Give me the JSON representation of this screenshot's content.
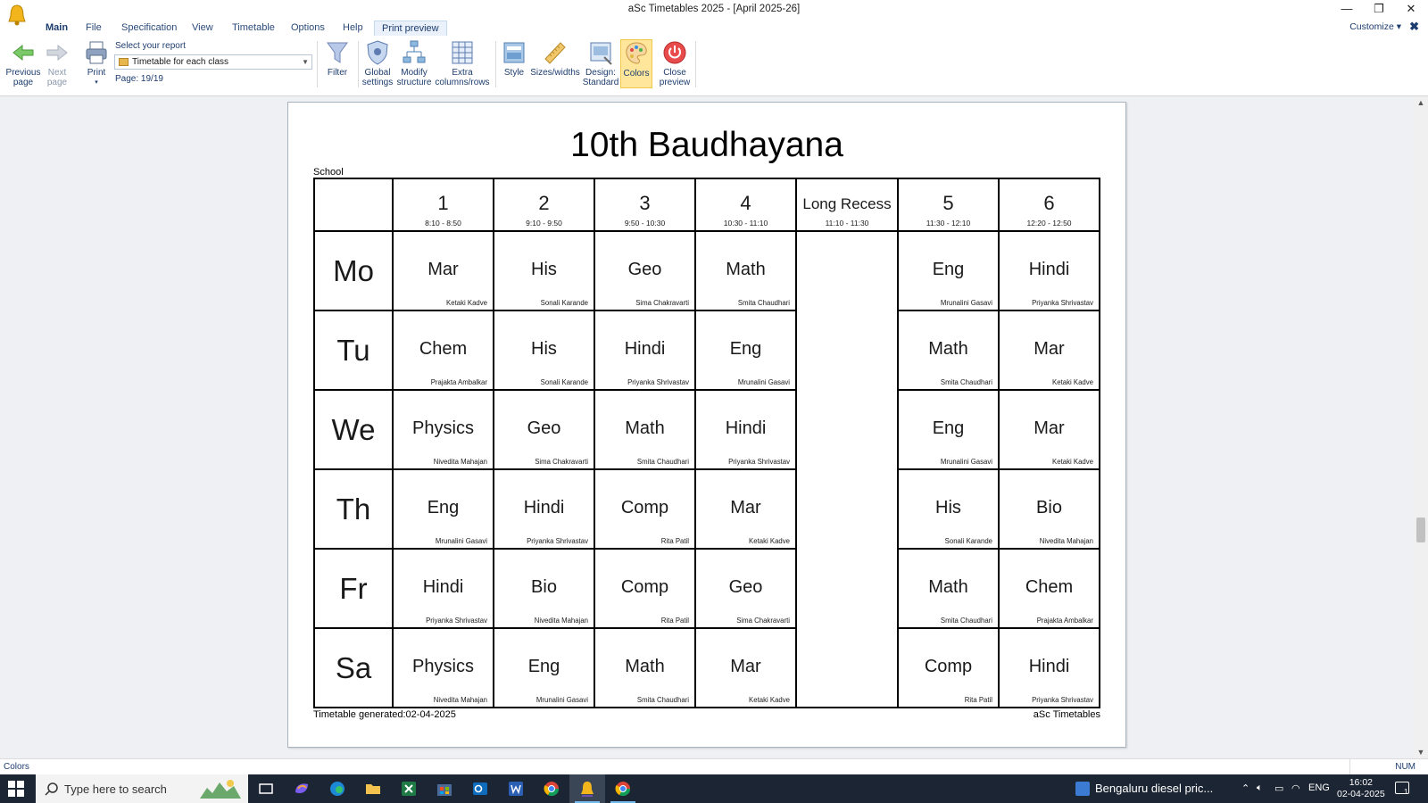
{
  "window": {
    "title": "aSc Timetables 2025  - [April 2025-26]",
    "minimize_label": "—",
    "maximize_label": "❐",
    "close_label": "✕"
  },
  "menu": {
    "tabs": [
      "Main",
      "File",
      "Specification",
      "View",
      "Timetable",
      "Options",
      "Help",
      "Print preview"
    ],
    "active_tab": "Print preview",
    "customize_label": "Customize ▾",
    "customize_close": "✖"
  },
  "ribbon": {
    "previous_page": "Previous page",
    "next_page": "Next page",
    "print": "Print",
    "select_report_label": "Select your report",
    "selected_report": "Timetable for each class",
    "page_info": "Page: 19/19",
    "filter": "Filter",
    "global_settings": "Global settings",
    "modify_structure": "Modify structure",
    "extra_columns_rows": "Extra columns/rows",
    "style": "Style",
    "sizes_widths": "Sizes/widths",
    "design": "Design: Standard",
    "colors": "Colors",
    "close_preview": "Close preview"
  },
  "timetable": {
    "title": "10th Baudhayana",
    "school_label": "School",
    "periods": [
      {
        "label": "1",
        "time": "8:10 - 8:50"
      },
      {
        "label": "2",
        "time": "9:10 - 9:50"
      },
      {
        "label": "3",
        "time": "9:50 - 10:30"
      },
      {
        "label": "4",
        "time": "10:30 - 11:10"
      },
      {
        "label": "Long Recess",
        "time": "11:10 - 11:30"
      },
      {
        "label": "5",
        "time": "11:30 - 12:10"
      },
      {
        "label": "6",
        "time": "12:20 - 12:50"
      }
    ],
    "days": [
      {
        "day": "Mo",
        "lessons": [
          {
            "subject": "Mar",
            "teacher": "Ketaki Kadve"
          },
          {
            "subject": "His",
            "teacher": "Sonali Karande"
          },
          {
            "subject": "Geo",
            "teacher": "Sima Chakravarti"
          },
          {
            "subject": "Math",
            "teacher": "Smita Chaudhari"
          },
          {
            "subject": "Eng",
            "teacher": "Mrunalini Gasavi"
          },
          {
            "subject": "Hindi",
            "teacher": "Priyanka Shrivastav"
          }
        ]
      },
      {
        "day": "Tu",
        "lessons": [
          {
            "subject": "Chem",
            "teacher": "Prajakta Ambalkar"
          },
          {
            "subject": "His",
            "teacher": "Sonali Karande"
          },
          {
            "subject": "Hindi",
            "teacher": "Priyanka Shrivastav"
          },
          {
            "subject": "Eng",
            "teacher": "Mrunalini Gasavi"
          },
          {
            "subject": "Math",
            "teacher": "Smita Chaudhari"
          },
          {
            "subject": "Mar",
            "teacher": "Ketaki Kadve"
          }
        ]
      },
      {
        "day": "We",
        "lessons": [
          {
            "subject": "Physics",
            "teacher": "Nivedita Mahajan"
          },
          {
            "subject": "Geo",
            "teacher": "Sima Chakravarti"
          },
          {
            "subject": "Math",
            "teacher": "Smita Chaudhari"
          },
          {
            "subject": "Hindi",
            "teacher": "Priyanka Shrivastav"
          },
          {
            "subject": "Eng",
            "teacher": "Mrunalini Gasavi"
          },
          {
            "subject": "Mar",
            "teacher": "Ketaki Kadve"
          }
        ]
      },
      {
        "day": "Th",
        "lessons": [
          {
            "subject": "Eng",
            "teacher": "Mrunalini Gasavi"
          },
          {
            "subject": "Hindi",
            "teacher": "Priyanka Shrivastav"
          },
          {
            "subject": "Comp",
            "teacher": "Rita Patil"
          },
          {
            "subject": "Mar",
            "teacher": "Ketaki Kadve"
          },
          {
            "subject": "His",
            "teacher": "Sonali Karande"
          },
          {
            "subject": "Bio",
            "teacher": "Nivedita Mahajan"
          }
        ]
      },
      {
        "day": "Fr",
        "lessons": [
          {
            "subject": "Hindi",
            "teacher": "Priyanka Shrivastav"
          },
          {
            "subject": "Bio",
            "teacher": "Nivedita Mahajan"
          },
          {
            "subject": "Comp",
            "teacher": "Rita Patil"
          },
          {
            "subject": "Geo",
            "teacher": "Sima Chakravarti"
          },
          {
            "subject": "Math",
            "teacher": "Smita Chaudhari"
          },
          {
            "subject": "Chem",
            "teacher": "Prajakta Ambalkar"
          }
        ]
      },
      {
        "day": "Sa",
        "lessons": [
          {
            "subject": "Physics",
            "teacher": "Nivedita Mahajan"
          },
          {
            "subject": "Eng",
            "teacher": "Mrunalini Gasavi"
          },
          {
            "subject": "Math",
            "teacher": "Smita Chaudhari"
          },
          {
            "subject": "Mar",
            "teacher": "Ketaki Kadve"
          },
          {
            "subject": "Comp",
            "teacher": "Rita Patil"
          },
          {
            "subject": "Hindi",
            "teacher": "Priyanka Shrivastav"
          }
        ]
      }
    ],
    "footer_left": "Timetable generated:02-04-2025",
    "footer_right": "aSc Timetables"
  },
  "statusbar": {
    "left_text": "Colors",
    "right_text": "NUM"
  },
  "taskbar": {
    "search_placeholder": "Type here to search",
    "news_text": "Bengaluru diesel pric...",
    "language": "ENG",
    "time": "16:02",
    "date": "02-04-2025",
    "notification_count": "1"
  },
  "colors": {
    "accent": "#1d3d6e",
    "active_button": "#ffe69a",
    "taskbar": "#1c2533",
    "preview_bg": "#eef0f3"
  }
}
